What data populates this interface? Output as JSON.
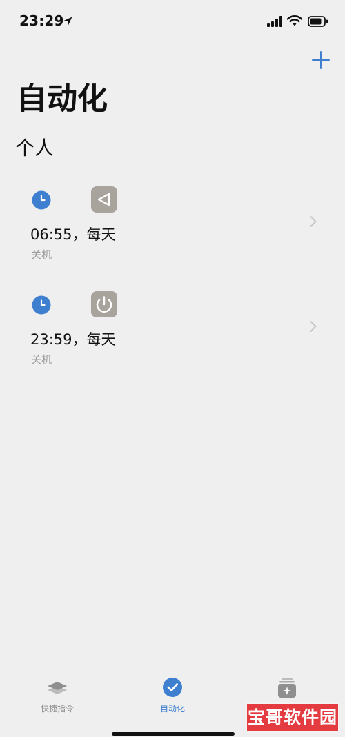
{
  "status_bar": {
    "time": "23:29"
  },
  "header": {
    "title": "自动化"
  },
  "section": {
    "title": "个人"
  },
  "automations": [
    {
      "time_text": "06:55，每天",
      "subtitle": "关机",
      "trigger_icon": "clock-icon",
      "action_icon": "play-back-icon"
    },
    {
      "time_text": "23:59，每天",
      "subtitle": "关机",
      "trigger_icon": "clock-icon",
      "action_icon": "power-icon"
    }
  ],
  "tabs": [
    {
      "label": "快捷指令",
      "icon": "stack-icon",
      "active": false
    },
    {
      "label": "自动化",
      "icon": "automation-check-icon",
      "active": true
    },
    {
      "label": "",
      "icon": "gallery-icon",
      "active": false
    }
  ],
  "watermark": {
    "text": "宝哥软件园"
  },
  "colors": {
    "background": "#efefef",
    "accent": "#3f7fcf",
    "action_tile": "#a8a39c",
    "inactive_tab": "#8f8f8f"
  }
}
